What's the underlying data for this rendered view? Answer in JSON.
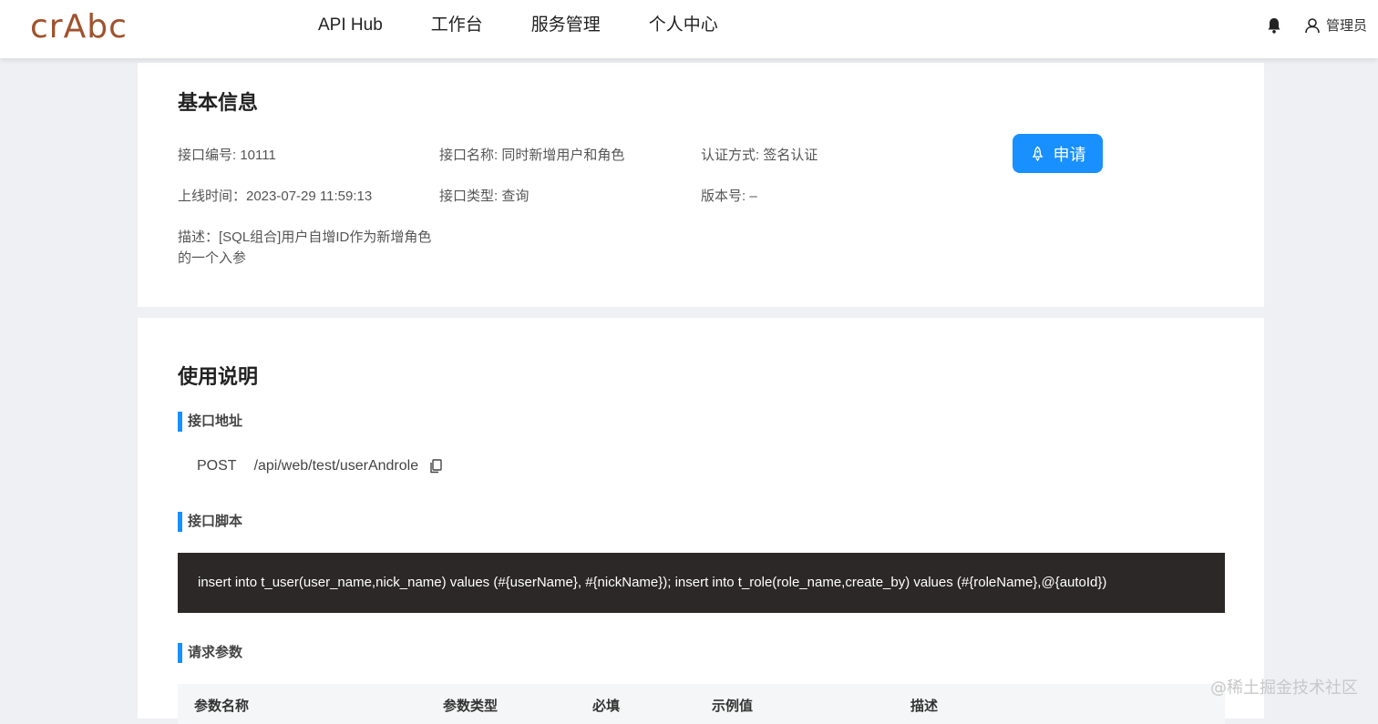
{
  "header": {
    "logo": "crAbc",
    "nav": [
      "API Hub",
      "工作台",
      "服务管理",
      "个人中心"
    ],
    "user_label": "管理员"
  },
  "basic_info": {
    "title": "基本信息",
    "api_id": "接口编号: 10111",
    "api_name": "接口名称: 同时新增用户和角色",
    "auth_method": "认证方式: 签名认证",
    "online_time": "上线时间：2023-07-29 11:59:13",
    "api_type": "接口类型: 查询",
    "version": "版本号: –",
    "desc_line1": "描述：[SQL组合]用户自增ID作为新增角色",
    "desc_line2": "的一个入参",
    "apply_label": "申请"
  },
  "usage": {
    "title": "使用说明",
    "endpoint_title": "接口地址",
    "method": "POST",
    "path": "/api/web/test/userAndrole",
    "script_title": "接口脚本",
    "script": "insert into t_user(user_name,nick_name) values (#{userName}, #{nickName}); insert into t_role(role_name,create_by) values (#{roleName},@{autoId})",
    "params_title": "请求参数",
    "params_columns": [
      "参数名称",
      "参数类型",
      "必填",
      "示例值",
      "描述"
    ]
  },
  "watermark": "@稀土掘金技术社区",
  "colors": {
    "accent": "#1890ff",
    "logo": "#a0522d",
    "code_bg": "#2b2827"
  },
  "icons": {
    "bell": "bell-icon",
    "user": "user-icon",
    "rocket": "rocket-icon",
    "copy": "copy-icon"
  }
}
